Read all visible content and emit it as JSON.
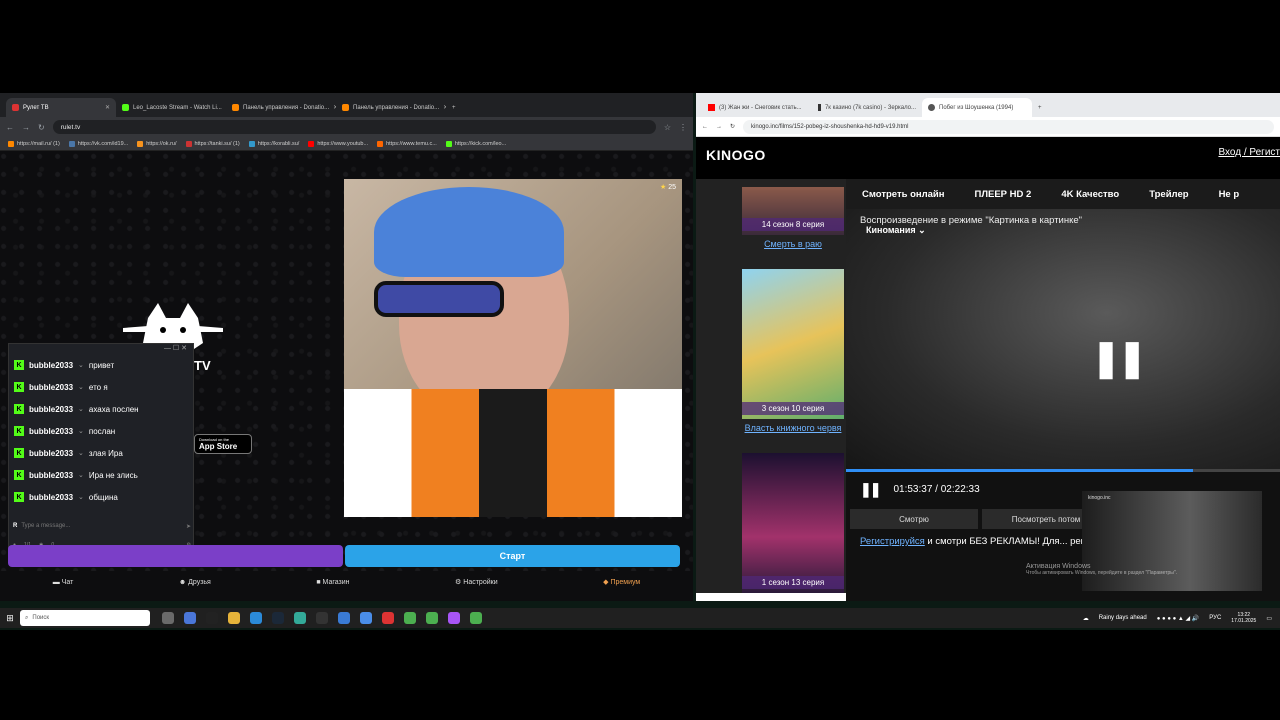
{
  "left_browser": {
    "tabs": [
      {
        "label": "Рулет ТВ",
        "active": true
      },
      {
        "label": "Leo_Lacoste Stream - Watch Li..."
      },
      {
        "label": "Панель управления - Donatio..."
      },
      {
        "label": "Панель управления - Donatio..."
      }
    ],
    "url": "rulet.tv",
    "bookmarks": [
      "https://mail.ru/ (1)",
      "https://vk.com/id19...",
      "https://ok.ru/",
      "https://tanki.su/ (1)",
      "https://korabli.su/",
      "https://www.youtub...",
      "https://www.temu.c...",
      "https://kick.com/leo..."
    ]
  },
  "ruletv": {
    "logo_text": "TV",
    "appstore_small": "Download on the",
    "appstore_big": "App Store",
    "cam_count": "25",
    "btn_left": "",
    "btn_right": "Старт",
    "nav": [
      "Чат",
      "Друзья",
      "Магазин",
      "Настройки",
      "Премиум"
    ]
  },
  "chat": {
    "messages": [
      {
        "user": "bubble2033",
        "text": "привет"
      },
      {
        "user": "bubble2033",
        "text": "ето я"
      },
      {
        "user": "bubble2033",
        "text": "ахаха послен"
      },
      {
        "user": "bubble2033",
        "text": "послан"
      },
      {
        "user": "bubble2033",
        "text": "злая Ира"
      },
      {
        "user": "bubble2033",
        "text": "Ира не злись"
      },
      {
        "user": "bubble2033",
        "text": "община"
      }
    ],
    "placeholder": "Type a message...",
    "footer_count1": "1/1",
    "footer_count2": "0"
  },
  "right_browser": {
    "tabs": [
      {
        "label": "(3) Жан жи - Снеговик стать..."
      },
      {
        "label": "7к казино (7k casino) - Зеркало..."
      },
      {
        "label": "Побег из Шоушенка (1994)",
        "active": true
      }
    ],
    "url": "kinogo.inc/films/152-pobeg-iz-shoushenka-hd-hd9-v19.html"
  },
  "kinogo": {
    "logo": "KINOGO",
    "login": "Вход / Регист",
    "posters": [
      {
        "label": "14 сезон 8 серия",
        "title": "Смерть в раю"
      },
      {
        "label": "3 сезон 10 серия",
        "title": "Власть книжного червя"
      },
      {
        "label": "1 сезон 13 серия",
        "title": ""
      }
    ],
    "player_tabs": [
      "Смотреть онлайн",
      "ПЛЕЕР HD 2",
      "4K Качество",
      "Трейлер",
      "Не р"
    ],
    "pip_text": "Воспроизведение в режиме \"Картинка в картинке\"",
    "source": "Киномания",
    "time": "01:53:37 / 02:22:33",
    "progress_fraction": 0.8,
    "src_buttons": [
      "Смотрю",
      "Посмотреть потом"
    ],
    "notice_link": "Регистрируйся",
    "notice_text": " и смотри БЕЗ РЕКЛАМЫ! Для... рекламу! Оставь комментарий :)",
    "mini_title": "kinogo.inc",
    "activate_title": "Активация Windows",
    "activate_sub": "Чтобы активировать Windows, перейдите в раздел \"Параметры\"."
  },
  "taskbar": {
    "search": "Поиск",
    "weather": "Rainy days ahead",
    "lang": "РУС",
    "time": "13:22",
    "date": "17.01.2025"
  }
}
